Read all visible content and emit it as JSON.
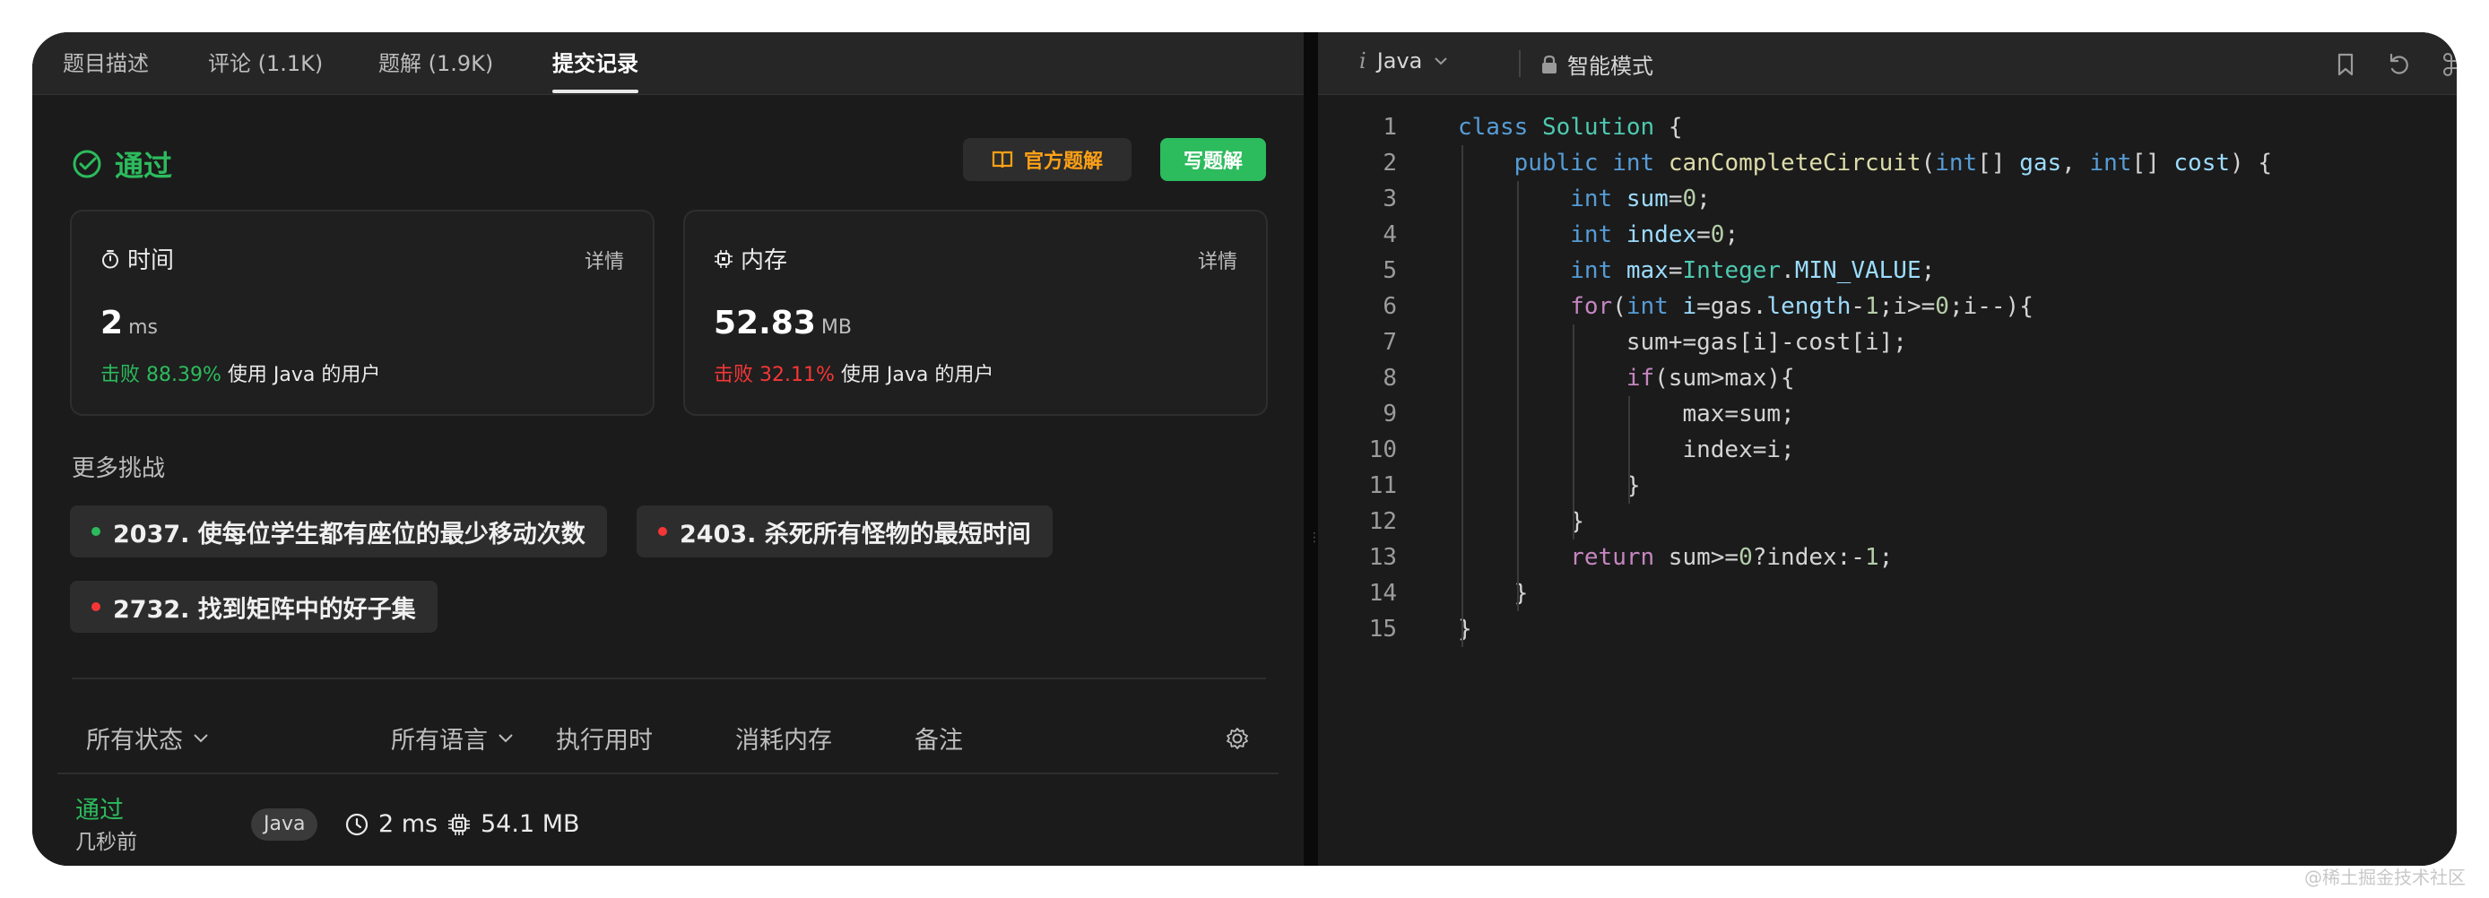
{
  "left_tabs": [
    "题目描述",
    "评论 (1.1K)",
    "题解 (1.9K)",
    "提交记录"
  ],
  "result": {
    "status": "通过",
    "official_solution_label": "官方题解",
    "write_solution_label": "写题解"
  },
  "runtime_card": {
    "title": "时间",
    "detail": "详情",
    "value": "2",
    "unit": "ms",
    "beat_prefix": "击败",
    "beat_pct": "88.39%",
    "beat_suffix": "使用 Java 的用户"
  },
  "memory_card": {
    "title": "内存",
    "detail": "详情",
    "value": "52.83",
    "unit": "MB",
    "beat_prefix": "击败",
    "beat_pct": "32.11%",
    "beat_suffix": "使用 Java 的用户"
  },
  "more_challenges": {
    "title": "更多挑战",
    "items": [
      {
        "label": "2037. 使每位学生都有座位的最少移动次数",
        "dot_color": "#2cbb5d"
      },
      {
        "label": "2403. 杀死所有怪物的最短时间",
        "dot_color": "#f63636"
      },
      {
        "label": "2732. 找到矩阵中的好子集",
        "dot_color": "#f63636"
      }
    ]
  },
  "table": {
    "headers": [
      "所有状态",
      "所有语言",
      "执行用时",
      "消耗内存",
      "备注"
    ],
    "rows": [
      {
        "status": "通过",
        "time_ago": "几秒前",
        "language": "Java",
        "runtime": "2 ms",
        "memory": "54.1 MB"
      }
    ]
  },
  "editor": {
    "language": "Java",
    "language_icon_glyph": "i",
    "mode": "智能模式",
    "line_numbers": [
      "1",
      "2",
      "3",
      "4",
      "5",
      "6",
      "7",
      "8",
      "9",
      "10",
      "11",
      "12",
      "13",
      "14",
      "15"
    ]
  },
  "colors": {
    "accent_green": "#2cbb5d",
    "accent_red": "#f63636",
    "accent_orange": "#ffa116"
  },
  "watermark": "@稀土掘金技术社区"
}
